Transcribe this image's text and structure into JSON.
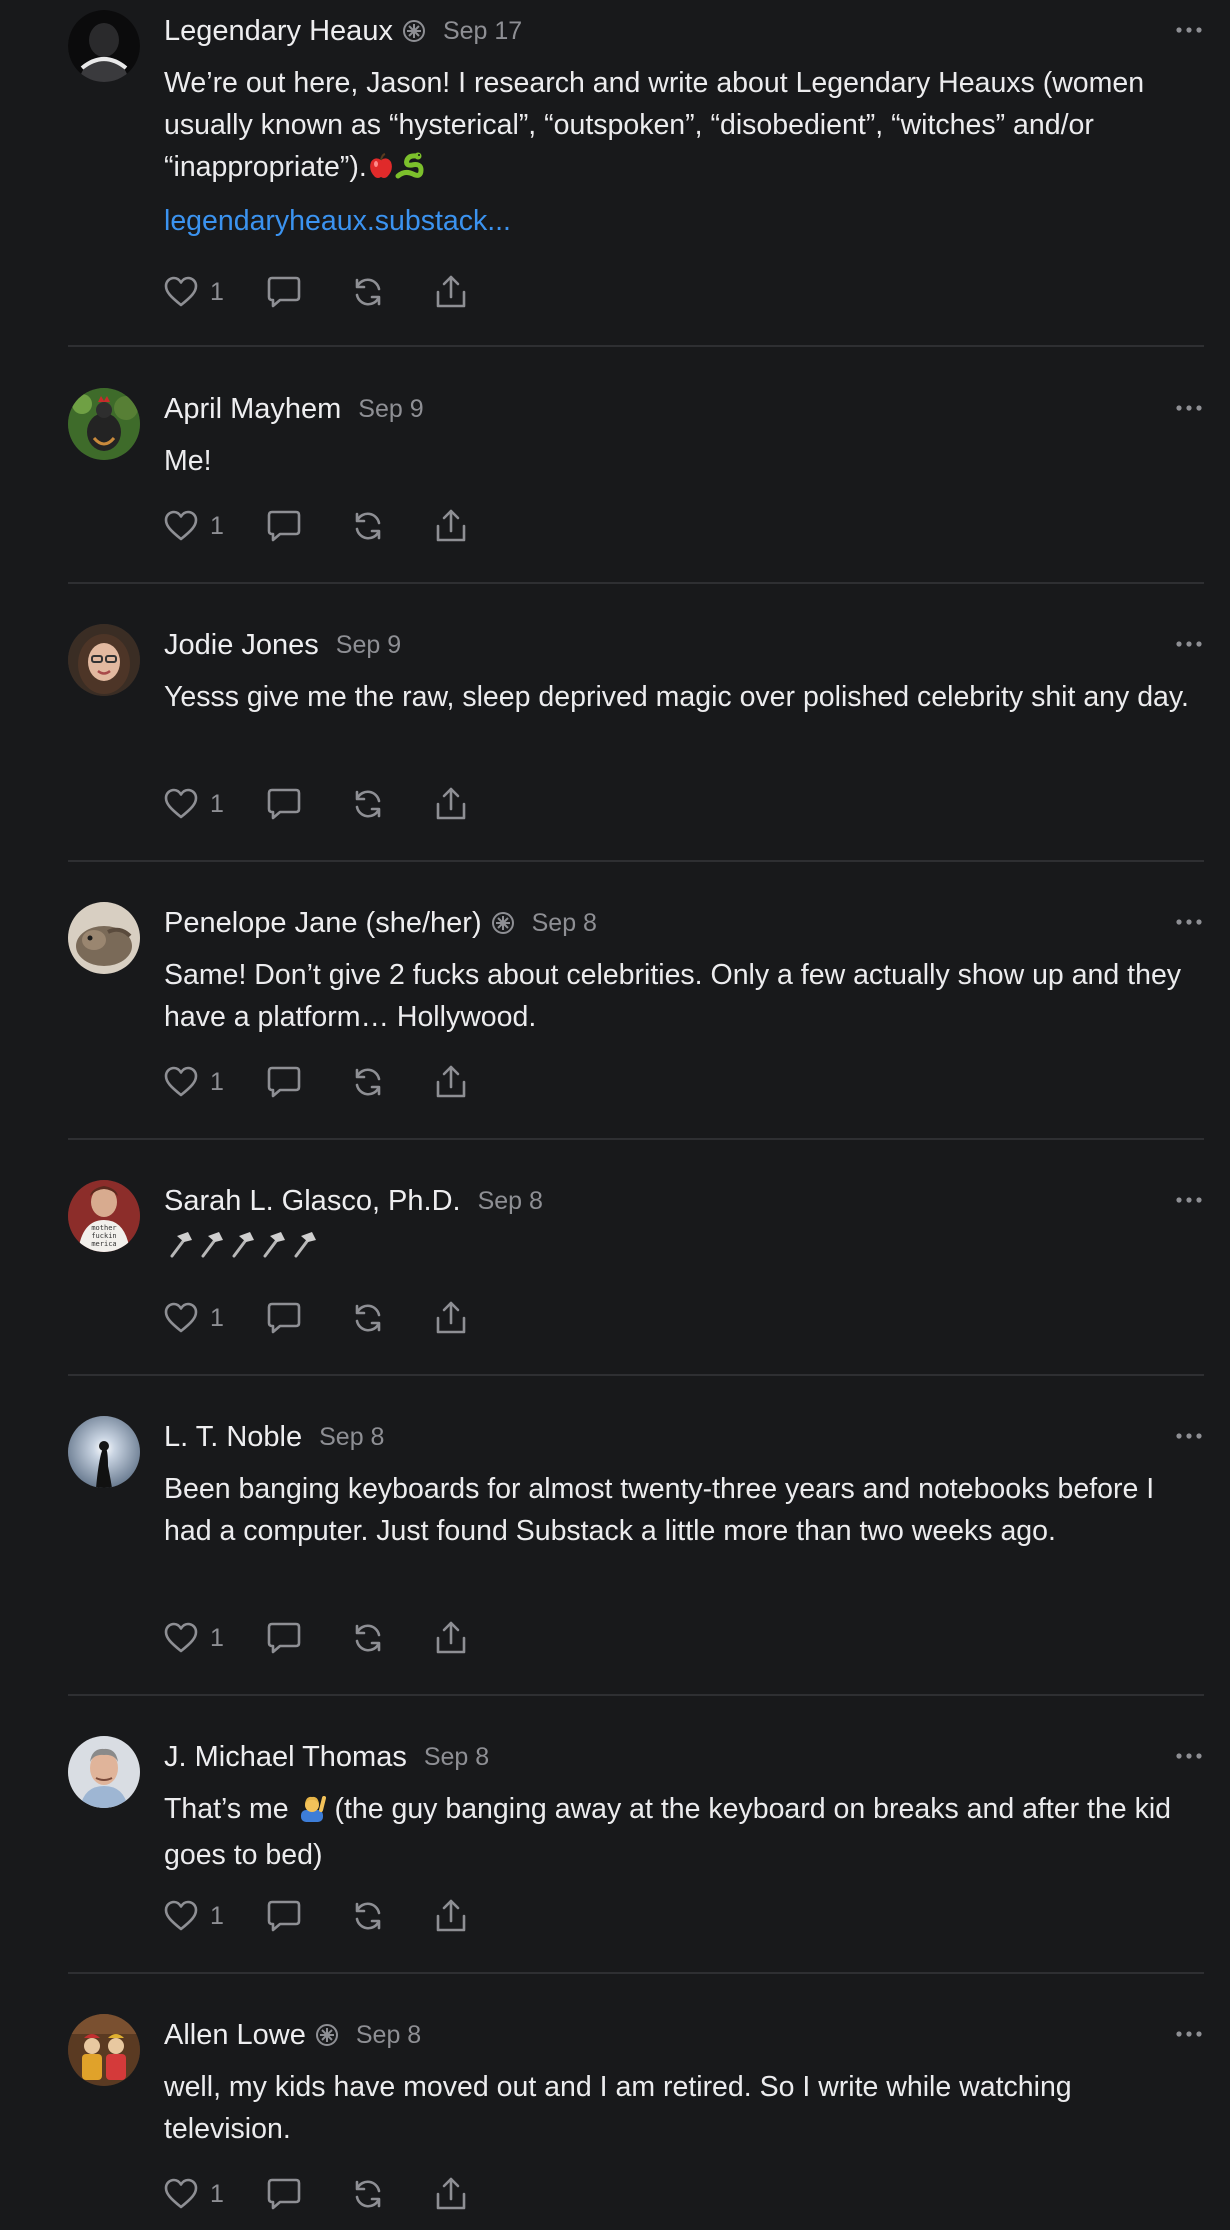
{
  "comments": [
    {
      "name": "Legendary Heaux",
      "date": "Sep 17",
      "text": "We’re out here, Jason! I research and write about Legendary Heauxs (women usually known as “hysterical”, “outspoken”, “disobedient”, “witches” and/or “inappropriate”).",
      "text_suffix_emoji": [
        "red-apple",
        "snake"
      ],
      "link": "legendaryheaux.substack...",
      "likes": "1",
      "badge": true
    },
    {
      "name": "April Mayhem",
      "date": "Sep 9",
      "text": "Me!",
      "likes": "1",
      "badge": false
    },
    {
      "name": "Jodie Jones",
      "date": "Sep 9",
      "text": "Yesss give me the raw, sleep deprived magic over polished celebrity shit any day.",
      "likes": "1",
      "badge": false
    },
    {
      "name": "Penelope Jane (she/her)",
      "date": "Sep 8",
      "text": "Same! Don’t give 2 fucks about celebrities. Only a few actually show up and they have a platform… Hollywood.",
      "likes": "1",
      "badge": true
    },
    {
      "name": "Sarah L. Glasco, Ph.D.",
      "date": "Sep 8",
      "text": "🔨🔨🔨🔨🔨",
      "text_is_icons": "hammer x5",
      "likes": "1",
      "badge": false
    },
    {
      "name": "L. T. Noble",
      "date": "Sep 8",
      "text": "Been banging keyboards for almost twenty-three years and notebooks before I had a computer. Just found Substack a little more than two weeks ago.",
      "likes": "1",
      "badge": false
    },
    {
      "name": "J. Michael Thomas",
      "date": "Sep 8",
      "text_before": "That’s me",
      "text_after": "(the guy banging away at the keyboard on breaks and after the kid goes to bed)",
      "text_emoji": "man-raising-hand",
      "likes": "1",
      "badge": false
    },
    {
      "name": "Allen Lowe",
      "date": "Sep 8",
      "text": "well, my kids have moved out and I am retired. So I write while watching television.",
      "likes": "1",
      "badge": true
    }
  ],
  "colors": {
    "background": "#18191b",
    "text": "#ececee",
    "muted": "#8e8f94",
    "link": "#3b93f0",
    "divider": "#2e2f32"
  },
  "icons": {
    "like": "heart-icon",
    "reply": "comment-bubble-icon",
    "restack": "restack-icon",
    "share": "share-icon",
    "more": "ellipsis-icon",
    "badge": "subscriber-badge-icon"
  }
}
